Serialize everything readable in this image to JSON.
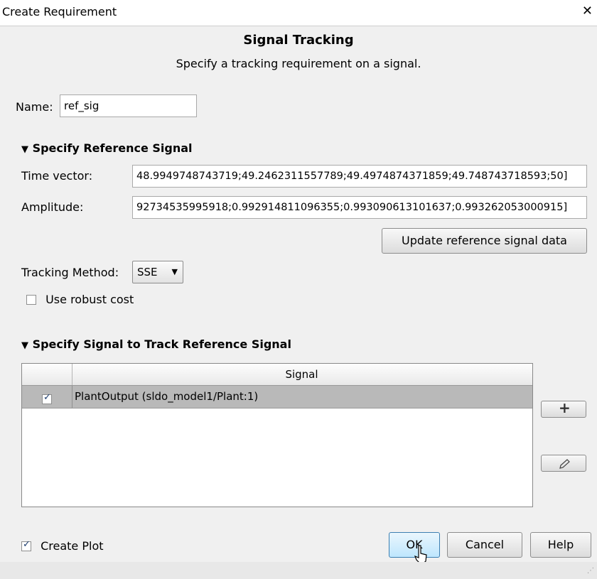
{
  "window": {
    "title": "Create Requirement",
    "close": "✕"
  },
  "header": {
    "title": "Signal Tracking",
    "subtitle": "Specify a tracking requirement on a signal."
  },
  "name": {
    "label": "Name:",
    "value": "ref_sig"
  },
  "reference": {
    "section_label": "Specify Reference Signal",
    "time_label": "Time vector:",
    "time_value": "48.9949748743719;49.2462311557789;49.4974874371859;49.748743718593;50]",
    "amplitude_label": "Amplitude:",
    "amplitude_value": "92734535995918;0.992914811096355;0.993090613101637;0.993262053000915]",
    "update_button": "Update reference signal data"
  },
  "tracking": {
    "label": "Tracking Method:",
    "value": "SSE",
    "robust_label": "Use robust cost",
    "robust_checked": false
  },
  "signals": {
    "section_label": "Specify Signal to Track Reference Signal",
    "column_header": "Signal",
    "rows": [
      {
        "checked": true,
        "name": "PlantOutput (sldo_model1/Plant:1)"
      }
    ]
  },
  "footer": {
    "create_plot_label": "Create Plot",
    "create_plot_checked": true,
    "ok": "OK",
    "cancel": "Cancel",
    "help": "Help"
  },
  "icons": {
    "add": "plus-icon",
    "edit": "pencil-icon",
    "section_toggle": "triangle-down-icon"
  }
}
